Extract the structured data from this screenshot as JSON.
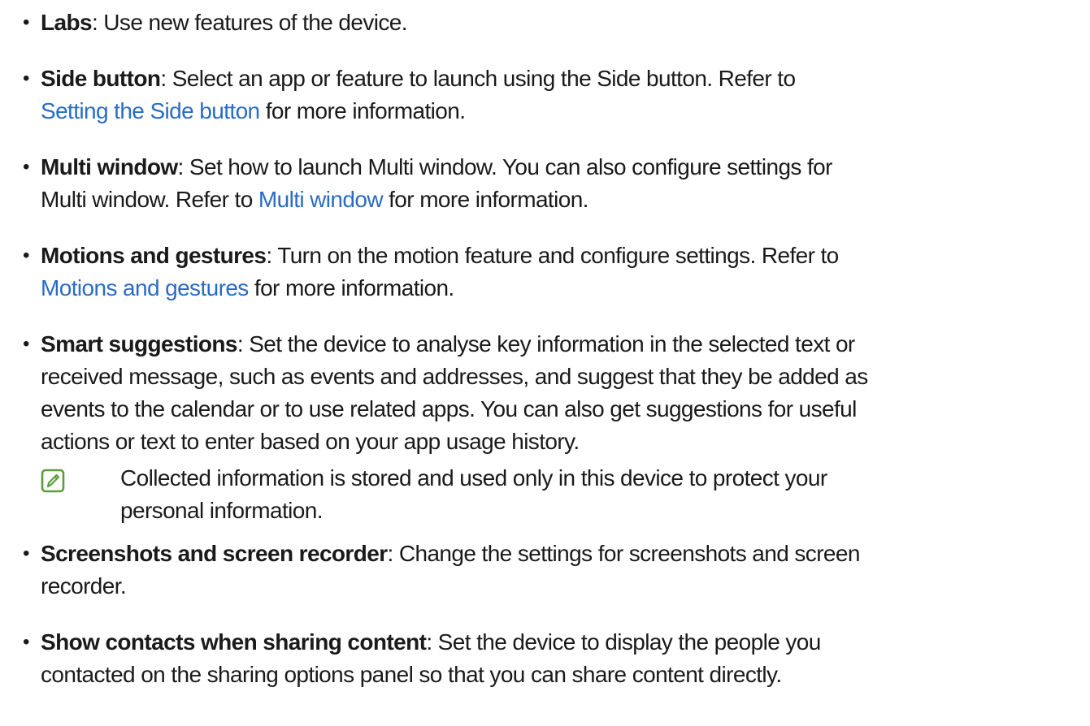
{
  "bullet_glyph": "•",
  "link_color": "#2a6cc4",
  "note_icon_color": "#5a9e3a",
  "items": [
    {
      "term": "Labs",
      "line1": ": Use new features of the device."
    },
    {
      "term": "Side button",
      "line1": ": Select an app or feature to launch using the Side button. Refer to",
      "link": "Setting the Side button",
      "line2_after": " for more information."
    },
    {
      "term": "Multi window",
      "line1": ": Set how to launch Multi window. You can also configure settings for",
      "line2_before": "Multi window. Refer to ",
      "link": "Multi window",
      "line2_after": " for more information."
    },
    {
      "term": "Motions and gestures",
      "line1": ": Turn on the motion feature and configure settings. Refer to",
      "link": "Motions and gestures",
      "line2_after": " for more information."
    },
    {
      "term": "Smart suggestions",
      "line1": ": Set the device to analyse key information in the selected text or",
      "line2": "received message, such as events and addresses, and suggest that they be added as",
      "line3": "events to the calendar or to use related apps. You can also get suggestions for useful",
      "line4": "actions or text to enter based on your app usage history.",
      "note_icon": "note-pencil-icon",
      "note_line1": "Collected information is stored and used only in this device to protect your",
      "note_line2": "personal information."
    },
    {
      "term": "Screenshots and screen recorder",
      "line1": ": Change the settings for screenshots and screen",
      "line2": "recorder."
    },
    {
      "term": "Show contacts when sharing content",
      "line1": ": Set the device to display the people you",
      "line2": "contacted on the sharing options panel so that you can share content directly."
    }
  ]
}
